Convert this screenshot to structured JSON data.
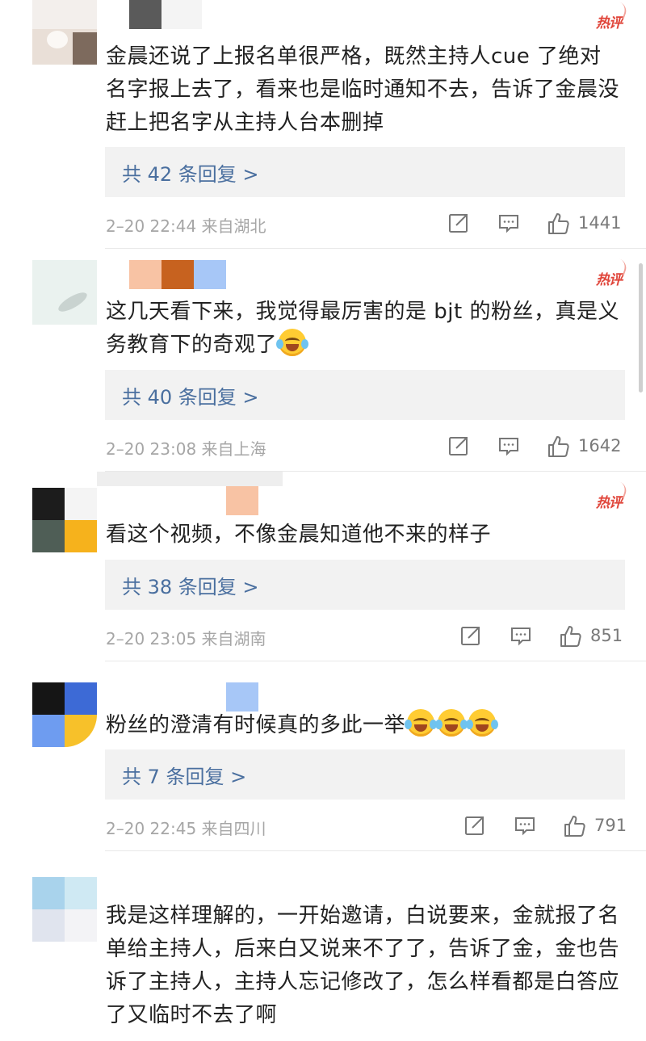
{
  "hot_label": "热评",
  "comments": [
    {
      "text": "金晨还说了上报名单很严格，既然主持人cue 了绝对名字报上去了，看来也是临时通知不去，告诉了金晨没赶上把名字从主持人台本删掉",
      "replies": "共 42 条回复 >",
      "meta": "2–20 22:44  来自湖北",
      "likes": "1441"
    },
    {
      "text": "这几天看下来，我觉得最厉害的是 bjt 的粉丝，真是义务教育下的奇观了",
      "emoji_count": 1,
      "replies": "共 40 条回复 >",
      "meta": "2–20 23:08  来自上海",
      "likes": "1642"
    },
    {
      "text": "看这个视频，不像金晨知道他不来的样子",
      "replies": "共 38 条回复 >",
      "meta": "2–20 23:05  来自湖南",
      "likes": "851"
    },
    {
      "text": "粉丝的澄清有时候真的多此一举",
      "emoji_count": 3,
      "replies": "共 7 条回复 >",
      "meta": "2–20 22:45  来自四川",
      "likes": "791"
    },
    {
      "text": "我是这样理解的，一开始邀请，白说要来，金就报了名单给主持人，后来白又说来不了了，告诉了金，金也告诉了主持人，主持人忘记修改了，怎么样看都是白答应了又临时不去了啊"
    }
  ],
  "icons": [
    "share-icon",
    "comment-icon",
    "thumbs-up-icon",
    "laughing-crying-emoji"
  ],
  "colors": {
    "hot": "#e0453a",
    "reply_link": "#4a6f9f",
    "reply_bg": "#f2f2f2",
    "meta": "#a6a6a6"
  }
}
